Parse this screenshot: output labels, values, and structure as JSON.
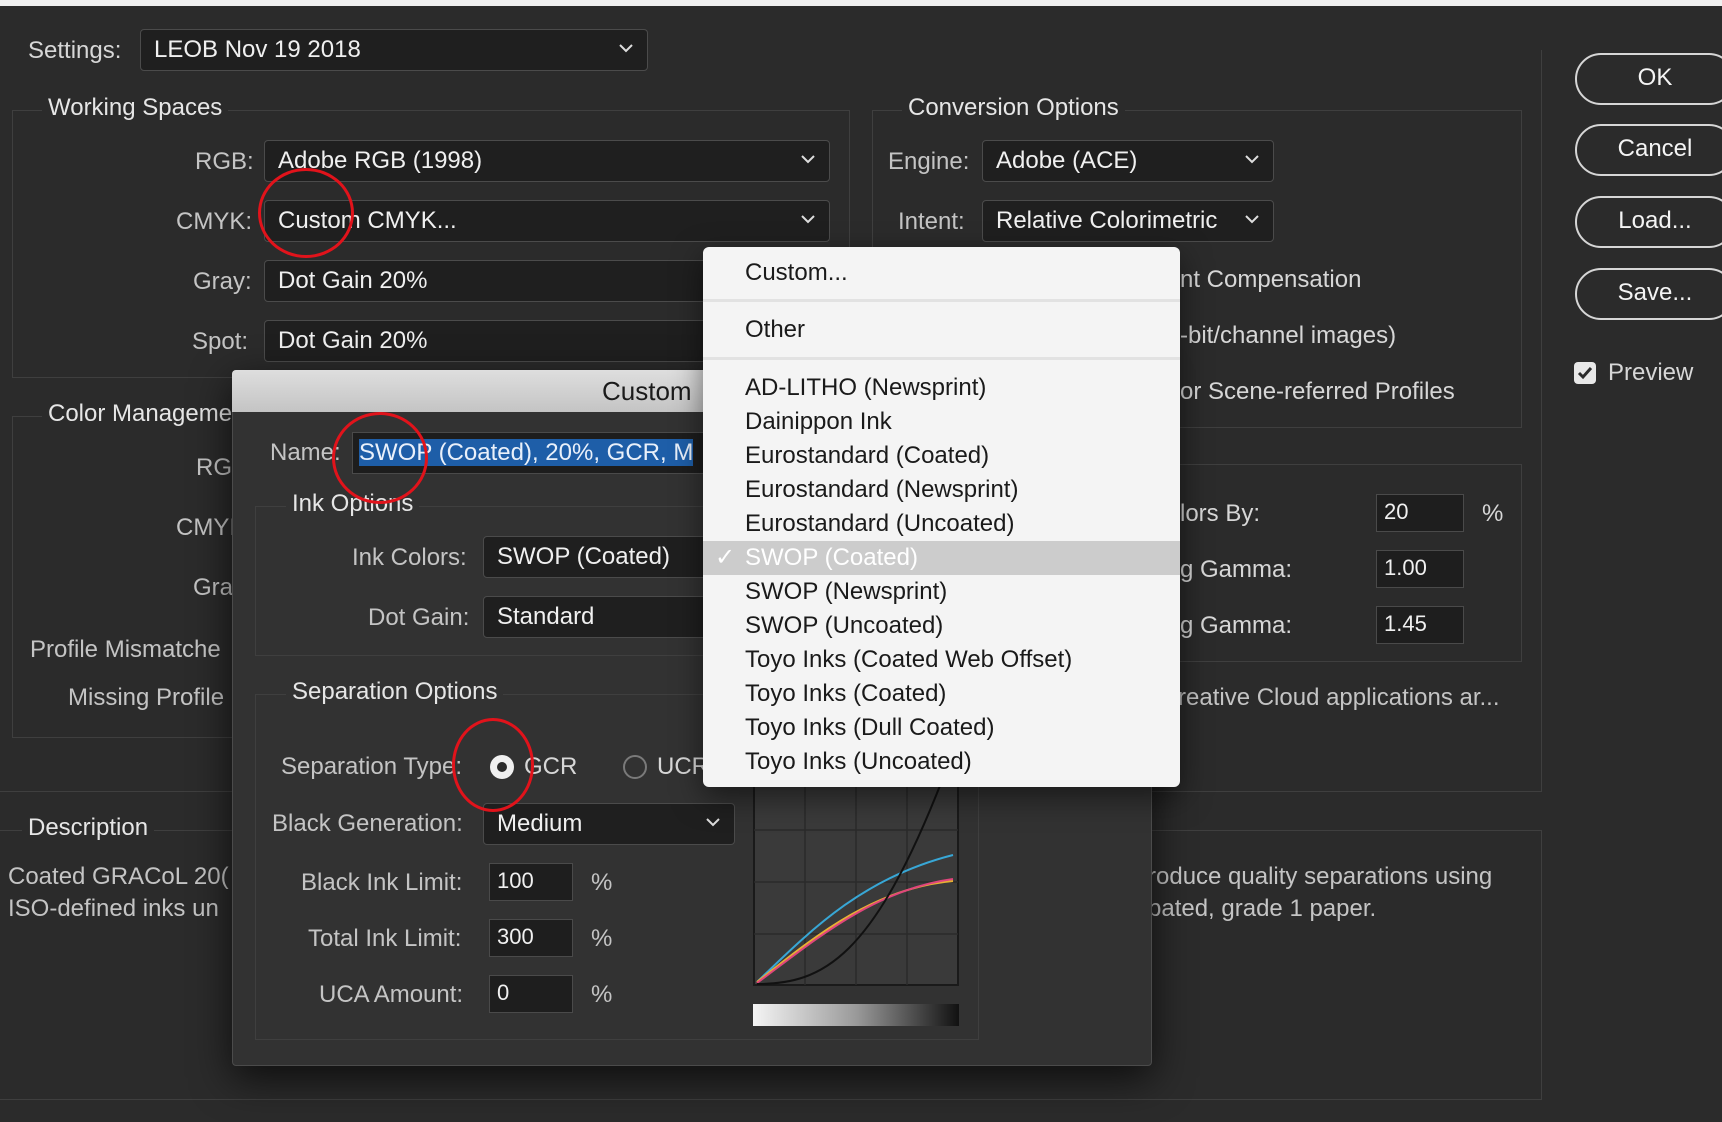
{
  "settings": {
    "label": "Settings:",
    "value": "LEOB Nov 19 2018"
  },
  "working_spaces": {
    "title": "Working Spaces",
    "rgb": {
      "label": "RGB:",
      "value": "Adobe RGB (1998)"
    },
    "cmyk": {
      "label": "CMYK:",
      "value": "Custom CMYK..."
    },
    "gray": {
      "label": "Gray:",
      "value": "Dot Gain 20%"
    },
    "spot": {
      "label": "Spot:",
      "value": "Dot Gain 20%"
    }
  },
  "color_management": {
    "title": "Color Manageme",
    "rgb_label": "RGI",
    "cmyk_label": "CMYI",
    "gray_label": "Gra",
    "profile_mismatch": "Profile Mismatche",
    "missing_profile": "Missing Profile"
  },
  "conversion": {
    "title": "Conversion Options",
    "engine": {
      "label": "Engine:",
      "value": "Adobe (ACE)"
    },
    "intent": {
      "label": "Intent:",
      "value": "Relative Colorimetric"
    },
    "bpc": "nt Compensation",
    "dither": "-bit/channel images)",
    "scene": "or Scene-referred Profiles"
  },
  "advanced": {
    "desaturate": {
      "label": "lors By:",
      "value": "20",
      "unit": "%"
    },
    "blend_rgb": {
      "label": "g Gamma:",
      "value": "1.00"
    },
    "blend_text": {
      "label": "g Gamma:",
      "value": "1.45"
    },
    "sync": "reative Cloud applications ar..."
  },
  "description": {
    "title": "Description",
    "line1": "Coated GRACoL 20(",
    "line2": "ISO-defined inks un",
    "right1": "roduce quality separations using",
    "right2": "bated, grade 1 paper."
  },
  "buttons": {
    "ok": "OK",
    "cancel": "Cancel",
    "load": "Load...",
    "save": "Save..."
  },
  "preview": {
    "label": "Preview",
    "checked": true
  },
  "custom_dialog": {
    "title": "Custom",
    "name_label": "Name:",
    "name_value": "SWOP (Coated), 20%, GCR, M",
    "ink_options": {
      "title": "Ink Options",
      "ink_colors": {
        "label": "Ink Colors:",
        "value": "SWOP (Coated)"
      },
      "dot_gain": {
        "label": "Dot Gain:",
        "value": "Standard"
      }
    },
    "separation_options": {
      "title": "Separation Options",
      "type_label": "Separation Type:",
      "gcr": "GCR",
      "ucr": "UCR",
      "black_generation": {
        "label": "Black Generation:",
        "value": "Medium"
      },
      "black_ink_limit": {
        "label": "Black Ink Limit:",
        "value": "100",
        "unit": "%"
      },
      "total_ink_limit": {
        "label": "Total Ink Limit:",
        "value": "300",
        "unit": "%"
      },
      "uca_amount": {
        "label": "UCA Amount:",
        "value": "0",
        "unit": "%"
      }
    }
  },
  "ink_menu": {
    "items": [
      "Custom...",
      "Other",
      "AD-LITHO (Newsprint)",
      "Dainippon Ink",
      "Eurostandard (Coated)",
      "Eurostandard (Newsprint)",
      "Eurostandard (Uncoated)",
      "SWOP (Coated)",
      "SWOP (Newsprint)",
      "SWOP (Uncoated)",
      "Toyo Inks (Coated Web Offset)",
      "Toyo Inks (Coated)",
      "Toyo Inks (Dull Coated)",
      "Toyo Inks (Uncoated)"
    ],
    "selected": "SWOP (Coated)",
    "check_mark": "✓"
  },
  "colors": {
    "annotation": "#e1131b",
    "highlight": "#1e5ea8",
    "curve_cyan": "#38a7d6",
    "curve_magenta": "#e0457c",
    "curve_yellow": "#e6b133",
    "curve_black": "#111111"
  }
}
